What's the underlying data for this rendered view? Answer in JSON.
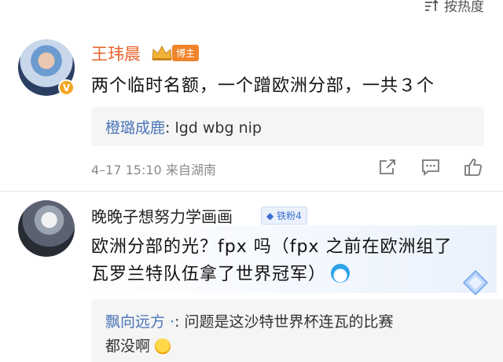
{
  "sort": {
    "label": "按热度",
    "icon": "sort-icon"
  },
  "comments": [
    {
      "username": "王玮晨",
      "badge": "博主",
      "verified_mark": "V",
      "text": "两个临时名额，一个蹭欧洲分部，一共３个",
      "reply": {
        "user": "橙璐成鹿",
        "text": ": lgd wbg nip"
      },
      "timestamp": "4–17 15:10",
      "location": "来自湖南",
      "actions": [
        "share-icon",
        "comment-icon",
        "like-icon"
      ]
    },
    {
      "username": "晚晚子想努力学画画",
      "fan_badge": "铁粉4",
      "text_line1": "欧洲分部的光？fpx 吗（fpx 之前在欧洲组了",
      "text_line2": "瓦罗兰特队伍拿了世界冠军）",
      "reply": {
        "user": "飘向远方 ·",
        "text_line1": ": 问题是这沙特世界杯连瓦的比赛",
        "text_line2": "都没啊"
      }
    }
  ],
  "colors": {
    "blogger_name": "#e8632a",
    "reply_user": "#4a74b8",
    "fan_badge": "#3b6fd1"
  }
}
